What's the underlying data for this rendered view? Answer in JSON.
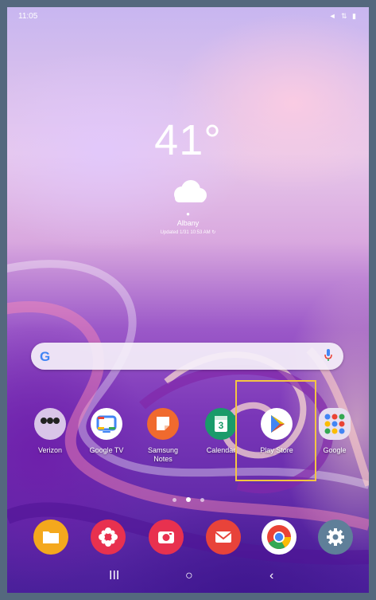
{
  "status_bar": {
    "time": "11:05",
    "icons": "◄ ⇅ ▮"
  },
  "weather": {
    "temperature": "41°",
    "location": "Albany",
    "updated": "Updated 1/31 10:53 AM ↻"
  },
  "search": {
    "logo": "G",
    "mic": "mic-icon"
  },
  "apps": [
    {
      "name": "verizon",
      "label": "Verizon"
    },
    {
      "name": "google-tv",
      "label": "Google TV"
    },
    {
      "name": "samsung-notes",
      "label": "Samsung Notes"
    },
    {
      "name": "calendar",
      "label": "Calendar",
      "day": "3"
    },
    {
      "name": "play-store",
      "label": "Play Store"
    },
    {
      "name": "google",
      "label": "Google"
    }
  ],
  "pager": {
    "pages": 3,
    "active": 1
  },
  "dock": [
    {
      "name": "my-files",
      "icon": "folder-icon",
      "color": "#f4a81d"
    },
    {
      "name": "galaxy-store",
      "icon": "flower-icon",
      "color": "#e8314f"
    },
    {
      "name": "camera",
      "icon": "camera-icon",
      "color": "#e8314f"
    },
    {
      "name": "email",
      "icon": "mail-icon",
      "color": "#e8433a"
    },
    {
      "name": "chrome",
      "icon": "chrome-icon",
      "color": "#ffffff"
    },
    {
      "name": "settings",
      "icon": "gear-icon",
      "color": "#5f7f99"
    }
  ],
  "navbar": {
    "recents": "III",
    "home": "○",
    "back": "‹"
  },
  "highlight_color": "#f4c542"
}
